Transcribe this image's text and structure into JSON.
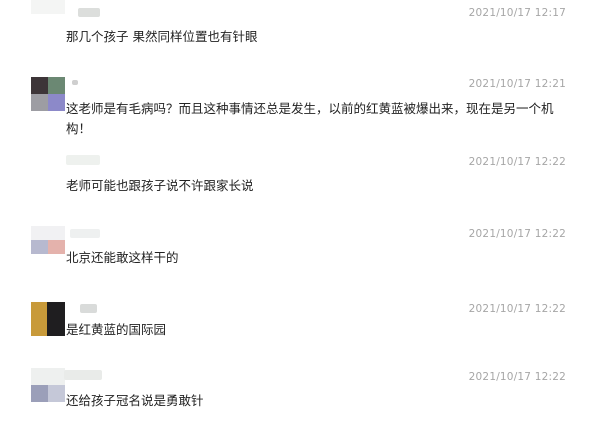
{
  "messages": [
    {
      "time": "2021/10/17 12:17",
      "text": "那几个孩子 果然同样位置也有针眼"
    },
    {
      "time": "2021/10/17 12:21",
      "text": "这老师是有毛病吗？而且这种事情还总是发生，以前的红黄蓝被爆出来，现在是另一个机构！"
    },
    {
      "time": "2021/10/17 12:22",
      "text": "老师可能也跟孩子说不许跟家长说"
    },
    {
      "time": "2021/10/17 12:22",
      "text": "北京还能敢这样干的"
    },
    {
      "time": "2021/10/17 12:22",
      "text": "是红黄蓝的国际园"
    },
    {
      "time": "2021/10/17 12:22",
      "text": "还给孩子冠名说是勇敢针"
    }
  ]
}
